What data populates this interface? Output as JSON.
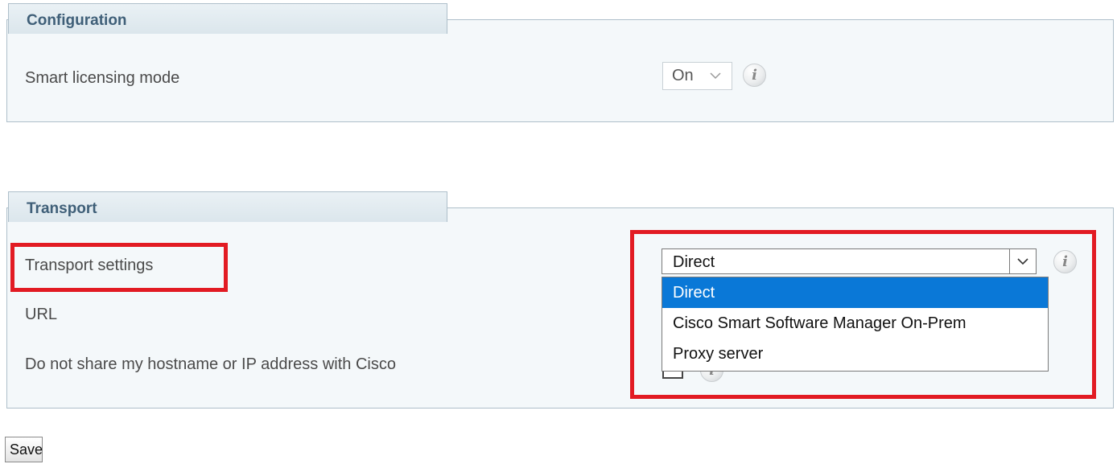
{
  "configuration": {
    "tab_label": "Configuration",
    "smart_licensing_label": "Smart licensing mode",
    "smart_licensing_value": "On"
  },
  "transport": {
    "tab_label": "Transport",
    "settings_label": "Transport settings",
    "url_label": "URL",
    "no_share_label": "Do not share my hostname or IP address with Cisco",
    "selected_value": "Direct",
    "options": [
      "Direct",
      "Cisco Smart Software Manager On-Prem",
      "Proxy server"
    ],
    "no_share_checked": false
  },
  "save_label": "Save",
  "info_glyph": "i",
  "icons": {
    "info": "info-icon",
    "chevron": "chevron-down-icon"
  },
  "colors": {
    "highlight": "#e21b23",
    "selected_option": "#0a78d7",
    "section_tab_text": "#3f5f78"
  }
}
